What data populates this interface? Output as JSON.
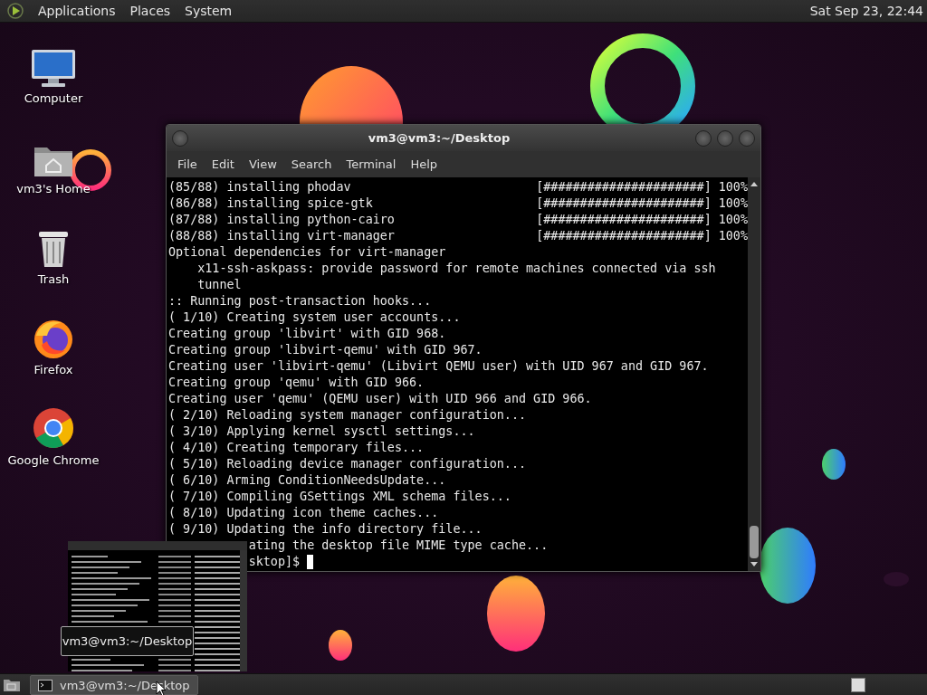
{
  "top_panel": {
    "menus": [
      "Applications",
      "Places",
      "System"
    ],
    "clock": "Sat Sep 23, 22:44"
  },
  "desktop_icons": [
    {
      "label": "Computer",
      "kind": "computer"
    },
    {
      "label": "vm3's Home",
      "kind": "home"
    },
    {
      "label": "Trash",
      "kind": "trash"
    },
    {
      "label": "Firefox",
      "kind": "firefox"
    },
    {
      "label": "Google Chrome",
      "kind": "chrome"
    }
  ],
  "terminal": {
    "title": "vm3@vm3:~/Desktop",
    "menus": [
      "File",
      "Edit",
      "View",
      "Search",
      "Terminal",
      "Help"
    ],
    "lines": [
      {
        "kind": "progress",
        "text": "(85/88) installing phodav",
        "bar": "[######################]",
        "percent": "100%"
      },
      {
        "kind": "progress",
        "text": "(86/88) installing spice-gtk",
        "bar": "[######################]",
        "percent": "100%"
      },
      {
        "kind": "progress",
        "text": "(87/88) installing python-cairo",
        "bar": "[######################]",
        "percent": "100%"
      },
      {
        "kind": "progress",
        "text": "(88/88) installing virt-manager",
        "bar": "[######################]",
        "percent": "100%"
      },
      {
        "kind": "line",
        "text": "Optional dependencies for virt-manager"
      },
      {
        "kind": "line",
        "text": "    x11-ssh-askpass: provide password for remote machines connected via ssh"
      },
      {
        "kind": "line",
        "text": "    tunnel"
      },
      {
        "kind": "line",
        "text": ":: Running post-transaction hooks..."
      },
      {
        "kind": "line",
        "text": "( 1/10) Creating system user accounts..."
      },
      {
        "kind": "line",
        "text": "Creating group 'libvirt' with GID 968."
      },
      {
        "kind": "line",
        "text": "Creating group 'libvirt-qemu' with GID 967."
      },
      {
        "kind": "line",
        "text": "Creating user 'libvirt-qemu' (Libvirt QEMU user) with UID 967 and GID 967."
      },
      {
        "kind": "line",
        "text": "Creating group 'qemu' with GID 966."
      },
      {
        "kind": "line",
        "text": "Creating user 'qemu' (QEMU user) with UID 966 and GID 966."
      },
      {
        "kind": "line",
        "text": "( 2/10) Reloading system manager configuration..."
      },
      {
        "kind": "line",
        "text": "( 3/10) Applying kernel sysctl settings..."
      },
      {
        "kind": "line",
        "text": "( 4/10) Creating temporary files..."
      },
      {
        "kind": "line",
        "text": "( 5/10) Reloading device manager configuration..."
      },
      {
        "kind": "line",
        "text": "( 6/10) Arming ConditionNeedsUpdate..."
      },
      {
        "kind": "line",
        "text": "( 7/10) Compiling GSettings XML schema files..."
      },
      {
        "kind": "line",
        "text": "( 8/10) Updating icon theme caches..."
      },
      {
        "kind": "line",
        "text": "( 9/10) Updating the info directory file..."
      },
      {
        "kind": "partial",
        "text": "ating the desktop file MIME type cache..."
      },
      {
        "kind": "prompt",
        "text": "sktop]$"
      }
    ]
  },
  "preview": {
    "tooltip": "vm3@vm3:~/Desktop"
  },
  "taskbar": {
    "tasks": [
      {
        "label": "vm3@vm3:~/Desktop",
        "selected": true
      }
    ]
  }
}
